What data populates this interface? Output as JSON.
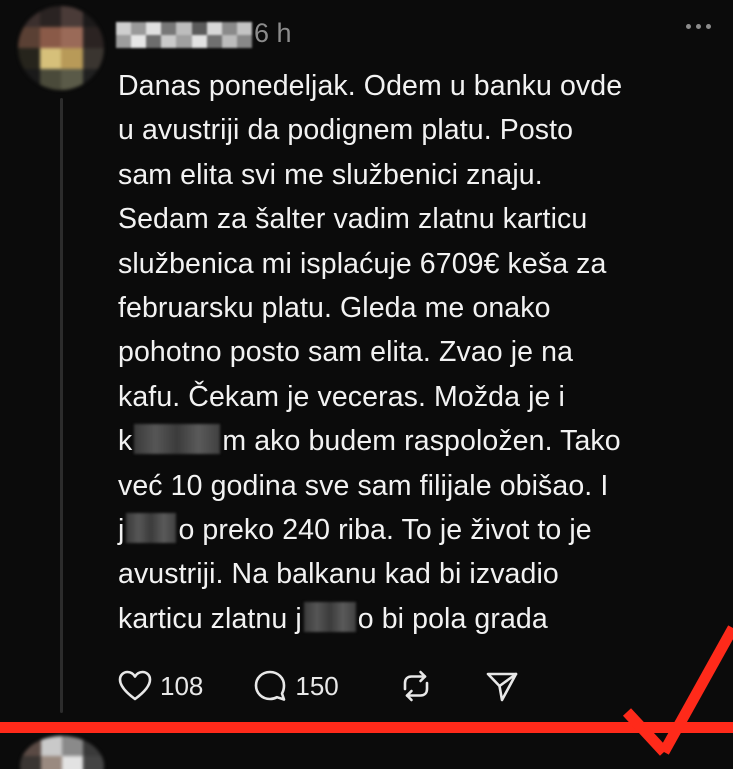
{
  "post": {
    "time": "6 h",
    "lines": [
      [
        "Danas ponedeljak. Odem u banku ovde"
      ],
      [
        "u avustriji da podignem platu. Posto"
      ],
      [
        "sam elita svi me službenici znaju."
      ],
      [
        "Sedam za šalter vadim zlatnu karticu"
      ],
      [
        "službenica mi isplaćuje 6709€ keša za"
      ],
      [
        "februarsku platu. Gleda me onako"
      ],
      [
        "pohotno posto sam elita. Zvao je na"
      ],
      [
        "kafu. Čekam je veceras. Možda je i"
      ],
      [
        "k",
        "m ako budem raspoložen. Tako"
      ],
      [
        "već 10 godina sve sam filijale obišao. I"
      ],
      [
        "j",
        "o preko 240 riba. To je život to je"
      ],
      [
        "avustriji. Na balkanu kad bi izvadio"
      ],
      [
        "karticu zlatnu j",
        "o bi pola grada"
      ]
    ]
  },
  "actions": {
    "likes": "108",
    "replies": "150"
  },
  "icons": {
    "like": "heart-icon",
    "reply": "comment-icon",
    "repost": "repost-icon",
    "share": "send-icon",
    "more": "more-icon"
  },
  "colors": {
    "background": "#0b0b0b",
    "text": "#f2f2f2",
    "muted": "#8c8c8c",
    "annotation": "#ff2a1a"
  }
}
